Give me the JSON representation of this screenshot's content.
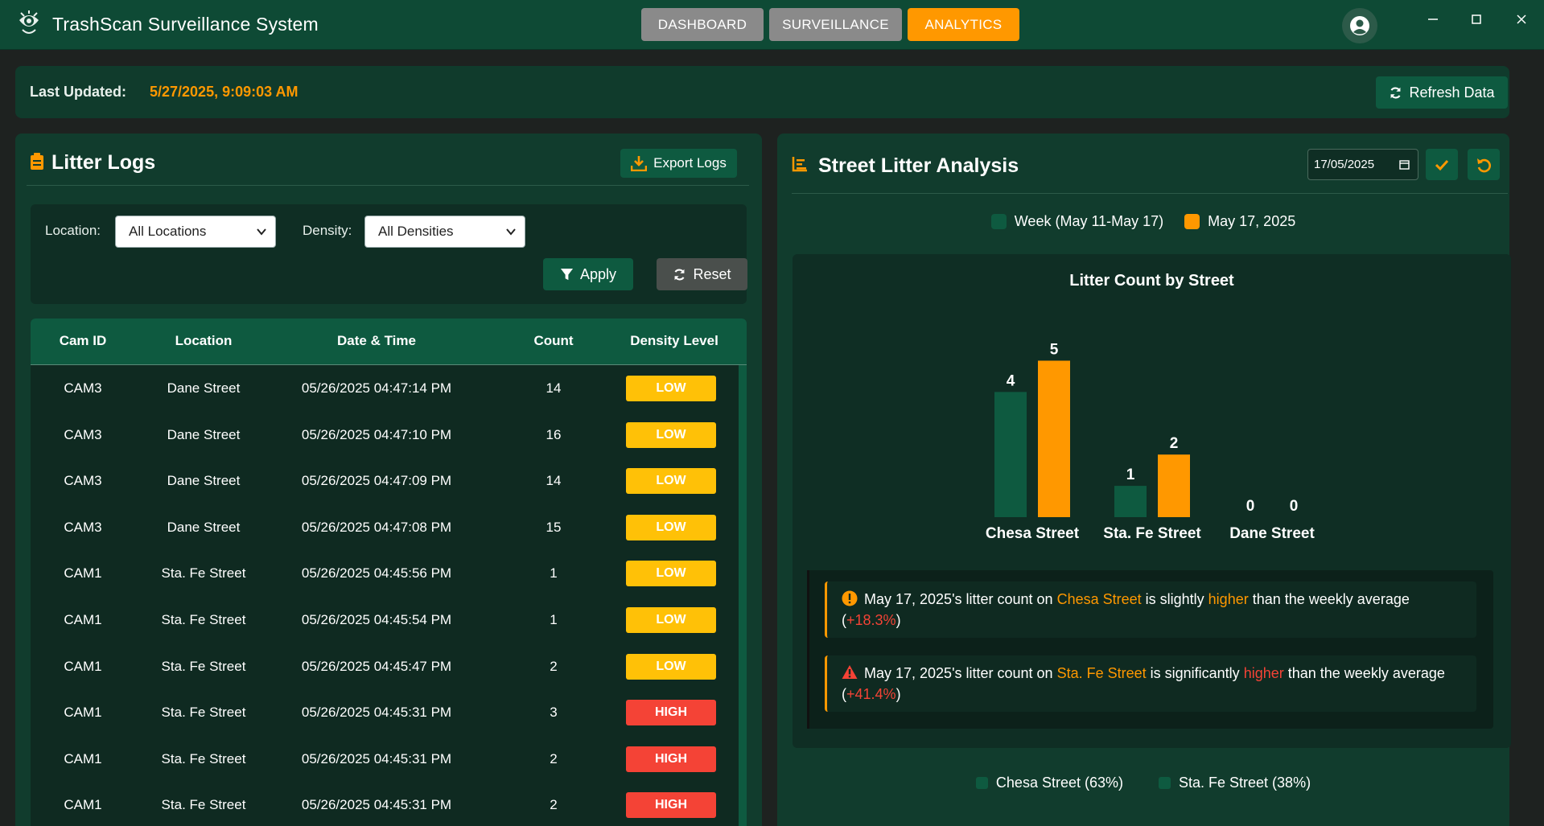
{
  "app": {
    "title": "TrashScan Surveillance System"
  },
  "nav": {
    "dashboard": "DASHBOARD",
    "surveillance": "SURVEILLANCE",
    "analytics": "ANALYTICS"
  },
  "status": {
    "label": "Last Updated:",
    "value": "5/27/2025, 9:09:03 AM",
    "refresh_label": "Refresh Data"
  },
  "logs": {
    "title": "Litter Logs",
    "export_label": "Export Logs",
    "filters": {
      "location_label": "Location:",
      "location_value": "All Locations",
      "density_label": "Density:",
      "density_value": "All Densities",
      "apply_label": "Apply",
      "reset_label": "Reset"
    },
    "columns": [
      "Cam ID",
      "Location",
      "Date & Time",
      "Count",
      "Density Level"
    ],
    "rows": [
      {
        "cam": "CAM3",
        "location": "Dane Street",
        "datetime": "05/26/2025 04:47:14 PM",
        "count": "14",
        "density": "LOW"
      },
      {
        "cam": "CAM3",
        "location": "Dane Street",
        "datetime": "05/26/2025 04:47:10 PM",
        "count": "16",
        "density": "LOW"
      },
      {
        "cam": "CAM3",
        "location": "Dane Street",
        "datetime": "05/26/2025 04:47:09 PM",
        "count": "14",
        "density": "LOW"
      },
      {
        "cam": "CAM3",
        "location": "Dane Street",
        "datetime": "05/26/2025 04:47:08 PM",
        "count": "15",
        "density": "LOW"
      },
      {
        "cam": "CAM1",
        "location": "Sta. Fe Street",
        "datetime": "05/26/2025 04:45:56 PM",
        "count": "1",
        "density": "LOW"
      },
      {
        "cam": "CAM1",
        "location": "Sta. Fe Street",
        "datetime": "05/26/2025 04:45:54 PM",
        "count": "1",
        "density": "LOW"
      },
      {
        "cam": "CAM1",
        "location": "Sta. Fe Street",
        "datetime": "05/26/2025 04:45:47 PM",
        "count": "2",
        "density": "LOW"
      },
      {
        "cam": "CAM1",
        "location": "Sta. Fe Street",
        "datetime": "05/26/2025 04:45:31 PM",
        "count": "3",
        "density": "HIGH"
      },
      {
        "cam": "CAM1",
        "location": "Sta. Fe Street",
        "datetime": "05/26/2025 04:45:31 PM",
        "count": "2",
        "density": "HIGH"
      },
      {
        "cam": "CAM1",
        "location": "Sta. Fe Street",
        "datetime": "05/26/2025 04:45:31 PM",
        "count": "2",
        "density": "HIGH"
      }
    ]
  },
  "analysis": {
    "title": "Street Litter Analysis",
    "date_value": "17/05/2025",
    "legend": [
      {
        "label": "Week (May 11-May 17)",
        "color": "#0e5a40"
      },
      {
        "label": "May 17, 2025",
        "color": "#ff9800"
      }
    ],
    "alerts": [
      {
        "icon": "exclamation-circle-icon",
        "prefix": "May 17, 2025's litter count on ",
        "street": "Chesa Street",
        "mid": " is slightly ",
        "direction": "higher",
        "suffix": " than the weekly average (",
        "pct": "+18.3%",
        "close": ")"
      },
      {
        "icon": "warning-triangle-icon",
        "prefix": "May 17, 2025's litter count on ",
        "street": "Sta. Fe Street",
        "mid": " is significantly ",
        "direction": "higher",
        "suffix": " than the weekly average (",
        "pct": "+41.4%",
        "close": ")"
      }
    ],
    "pie_legend": [
      {
        "label": "Chesa Street (63%)",
        "color": "#0e5a40"
      },
      {
        "label": "Sta. Fe Street (38%)",
        "color": "#0e5a40"
      }
    ]
  },
  "chart_data": {
    "type": "bar",
    "title": "Litter Count by Street",
    "categories": [
      "Chesa Street",
      "Sta. Fe Street",
      "Dane Street"
    ],
    "series": [
      {
        "name": "Week (May 11-May 17)",
        "values": [
          4,
          1,
          0
        ],
        "color": "#0e5a40"
      },
      {
        "name": "May 17, 2025",
        "values": [
          5,
          2,
          0
        ],
        "color": "#ff9800"
      }
    ],
    "ylim": [
      0,
      5.5
    ]
  }
}
